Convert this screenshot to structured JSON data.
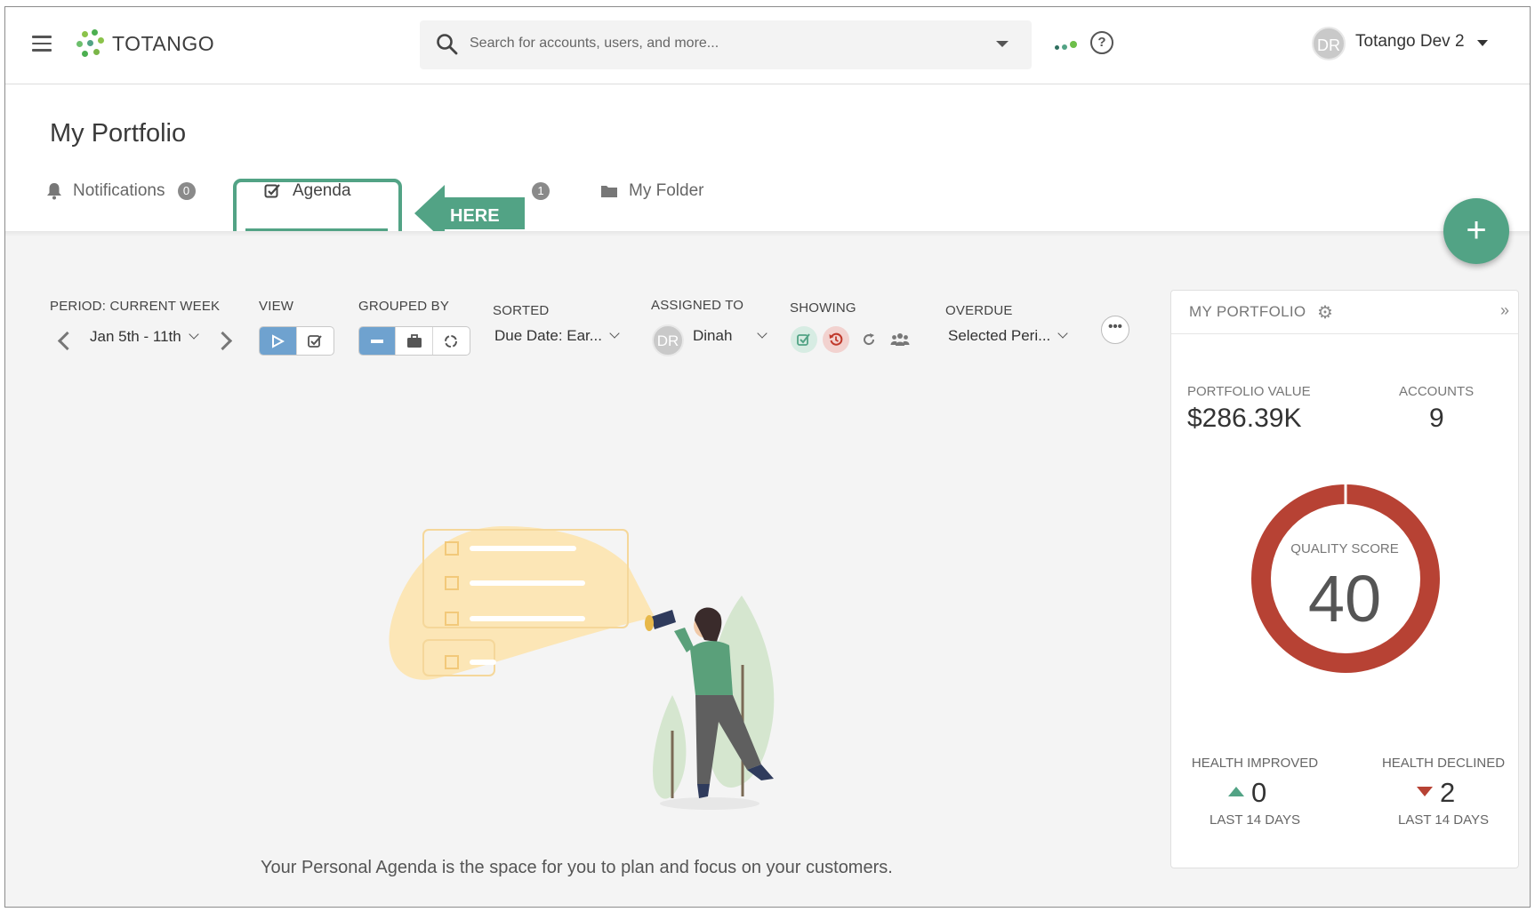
{
  "app": {
    "logo_text": "TOTANGO",
    "search_placeholder": "Search for accounts, users, and more...",
    "user_initials": "DR",
    "user_name": "Totango Dev 2",
    "accent_color": "#52a385"
  },
  "page": {
    "title": "My Portfolio",
    "tabs": [
      {
        "label": "Notifications",
        "badge": "0",
        "icon": "bell-icon"
      },
      {
        "label": "Agenda",
        "icon": "checkbox-icon",
        "active": true
      },
      {
        "label": "My Folder",
        "badge": "1",
        "icon": "folder-icon"
      }
    ],
    "callout": "HERE",
    "fab_label": "+"
  },
  "filters": {
    "period_label": "PERIOD: CURRENT WEEK",
    "period_value": "Jan 5th - 11th",
    "view_label": "VIEW",
    "grouped_label": "GROUPED BY",
    "sorted_label": "SORTED",
    "sorted_value": "Due Date: Ear...",
    "assigned_label": "ASSIGNED TO",
    "assigned_initials": "DR",
    "assigned_value": "Dinah",
    "showing_label": "SHOWING",
    "overdue_label": "OVERDUE",
    "overdue_value": "Selected Peri...",
    "more_label": "•••"
  },
  "empty_state": {
    "text": "Your Personal Agenda is the space for you to plan and focus on your customers."
  },
  "portfolio": {
    "title": "MY PORTFOLIO",
    "value_label": "PORTFOLIO VALUE",
    "value": "$286.39K",
    "accounts_label": "ACCOUNTS",
    "accounts": "9",
    "quality_label": "QUALITY SCORE",
    "quality_score": "40",
    "health_improved_label": "HEALTH IMPROVED",
    "health_improved": "0",
    "health_declined_label": "HEALTH DECLINED",
    "health_declined": "2",
    "period_note": "LAST 14 DAYS",
    "donut_color": "#b74234"
  }
}
